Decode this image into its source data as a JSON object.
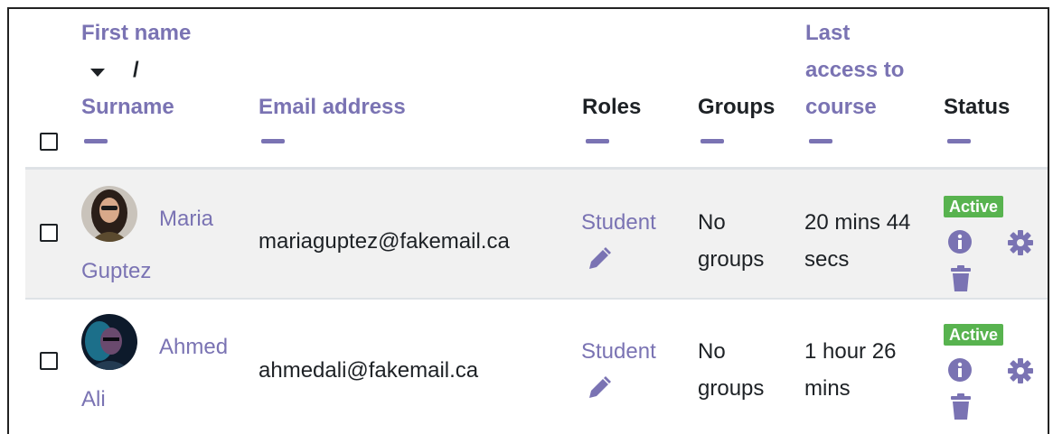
{
  "header": {
    "first_name_line1": "First name",
    "sort_slash": "/",
    "surname": "Surname",
    "email": "Email address",
    "roles": "Roles",
    "groups": "Groups",
    "last_access_line1": "Last",
    "last_access_line2": "access to",
    "last_access_line3": "course",
    "status": "Status"
  },
  "rows": [
    {
      "first": "Maria",
      "last": "Guptez",
      "email": "mariaguptez@fakemail.ca",
      "role": "Student",
      "groups_line1": "No",
      "groups_line2": "groups",
      "access_line1": "20 mins 44",
      "access_line2": "secs",
      "status": "Active"
    },
    {
      "first": "Ahmed",
      "last": "Ali",
      "email": "ahmedali@fakemail.ca",
      "role": "Student",
      "groups_line1": "No",
      "groups_line2": "groups",
      "access_line1": "1 hour 26",
      "access_line2": "mins",
      "status": "Active"
    }
  ],
  "colors": {
    "link": "#7a73b3",
    "text": "#1d2125",
    "badge": "#58b34f",
    "row_alt": "#f1f1f1"
  },
  "icons": [
    "sort-desc-icon",
    "collapse-dash-icon",
    "pencil-icon",
    "info-icon",
    "gear-icon",
    "trash-icon"
  ]
}
